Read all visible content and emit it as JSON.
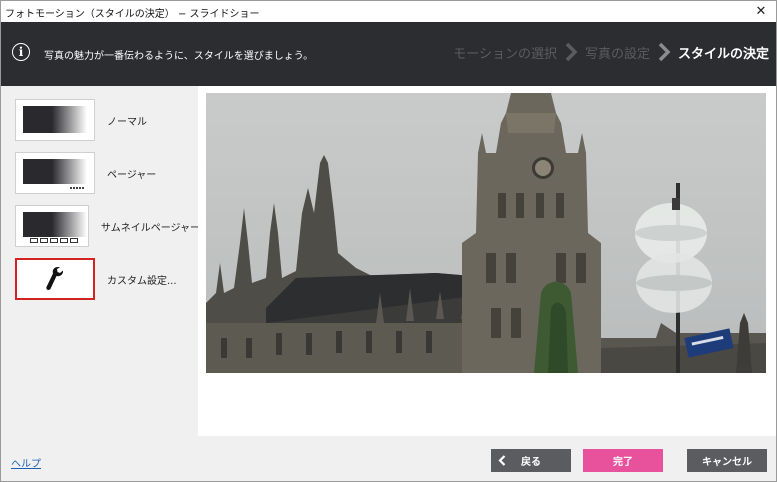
{
  "window": {
    "title": "フォトモーション（スタイルの決定） − スライドショー",
    "close_glyph": "✕"
  },
  "banner": {
    "info_glyph": "i",
    "message": "写真の魅力が一番伝わるように、スタイルを選びましょう。",
    "steps": [
      {
        "label": "モーションの選択",
        "state": "inactive"
      },
      {
        "label": "写真の設定",
        "state": "inactive"
      },
      {
        "label": "スタイルの決定",
        "state": "active"
      }
    ]
  },
  "styles": [
    {
      "label": "ノーマル",
      "thumb": "normal"
    },
    {
      "label": "ページャー",
      "thumb": "pager"
    },
    {
      "label": "サムネイルページャー",
      "thumb": "thumbnail-pager"
    },
    {
      "label": "カスタム設定...",
      "thumb": "custom",
      "selected": true
    }
  ],
  "footer": {
    "help": "ヘルプ",
    "back": "戻る",
    "finish": "完了",
    "cancel": "キャンセル"
  },
  "colors": {
    "banner_bg": "#2b2d31",
    "finish_button": "#e8519b",
    "secondary_button": "#5a5c60",
    "selected_border": "#d22222",
    "inactive_step": "#5a5c60"
  },
  "icons": {
    "info": "info-icon",
    "step_separator": "chevron-right-icon",
    "back": "chevron-left-icon",
    "custom": "wrench-icon",
    "close": "close-icon"
  }
}
